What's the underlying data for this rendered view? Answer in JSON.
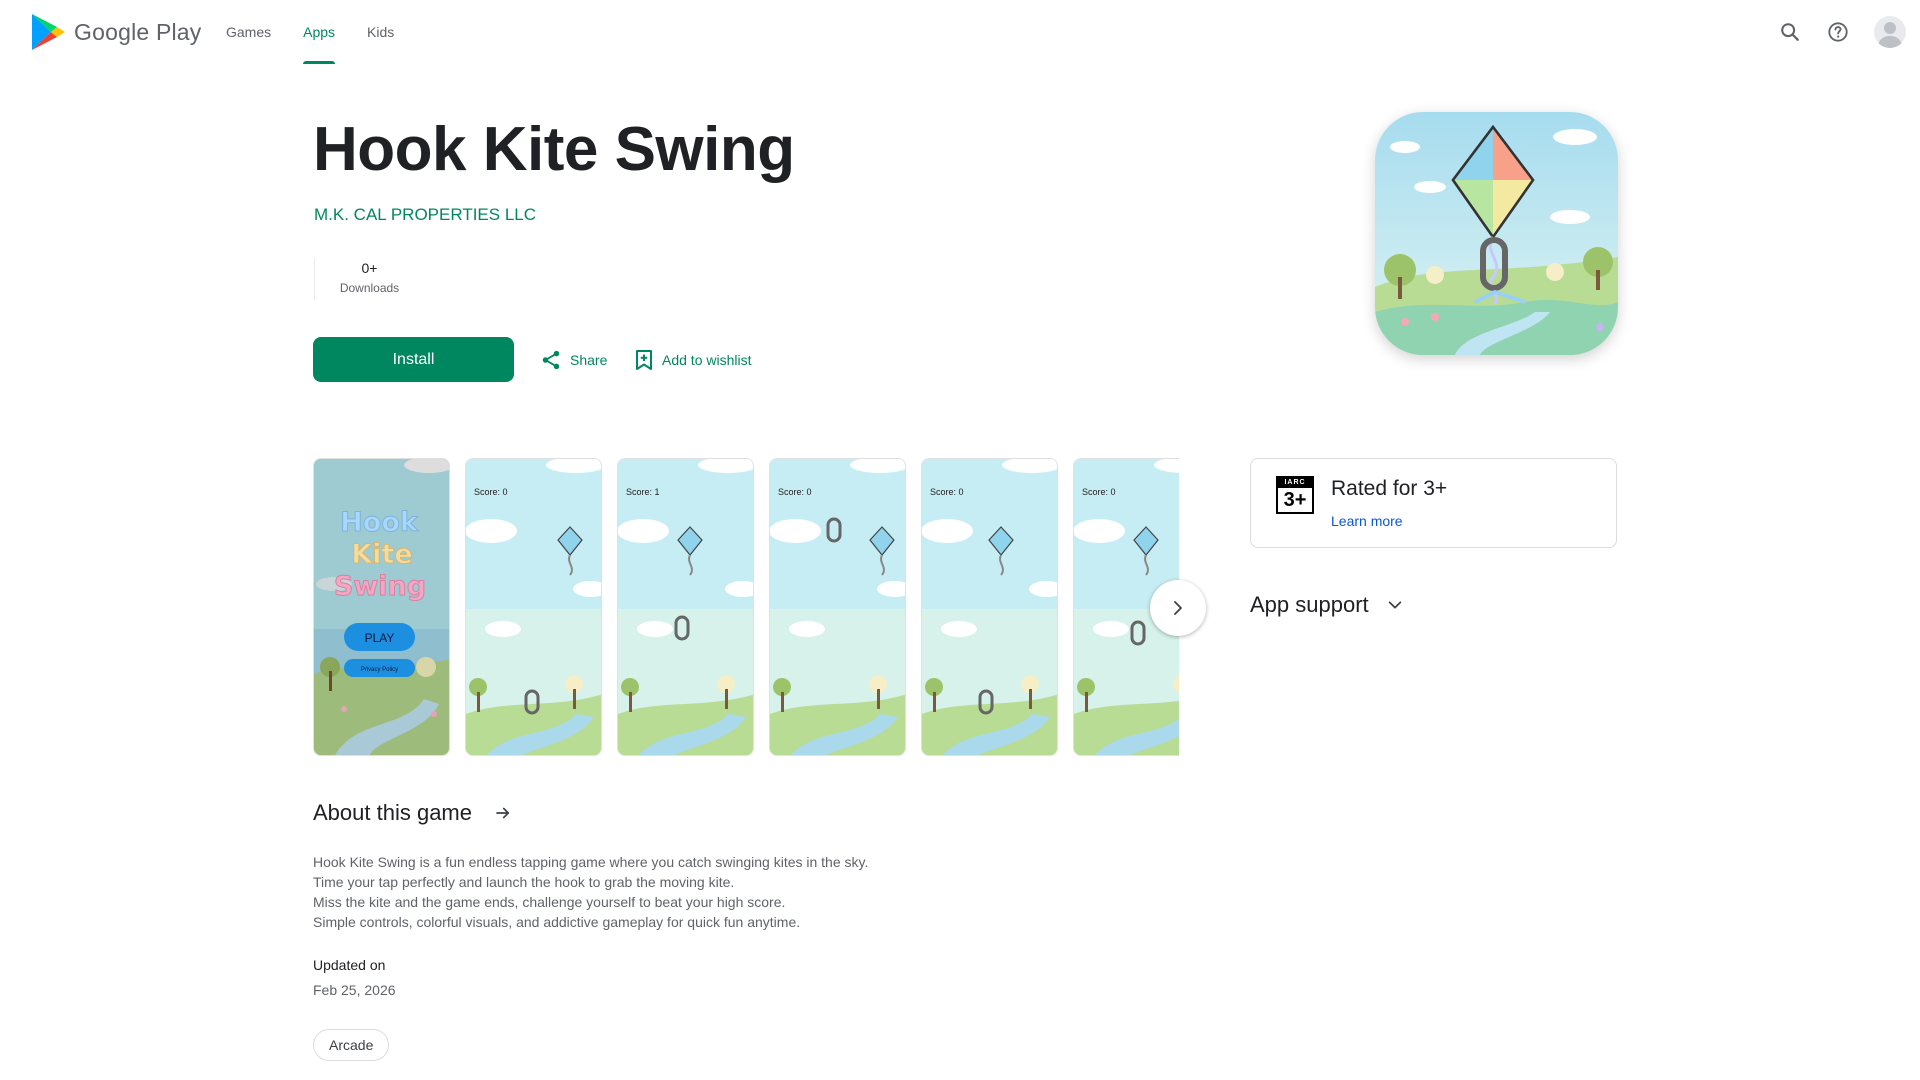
{
  "header": {
    "logo_text": "Google Play",
    "tabs": [
      {
        "label": "Games",
        "active": false
      },
      {
        "label": "Apps",
        "active": true
      },
      {
        "label": "Kids",
        "active": false
      }
    ],
    "icons": [
      "search-icon",
      "help-icon",
      "account-avatar"
    ]
  },
  "app": {
    "title": "Hook Kite Swing",
    "developer": "M.K. CAL PROPERTIES LLC",
    "stats": [
      {
        "value": "0+",
        "label": "Downloads"
      }
    ],
    "install_label": "Install",
    "share_label": "Share",
    "wishlist_label": "Add to wishlist"
  },
  "screenshots": [
    {
      "kind": "title",
      "title_lines": [
        "Hook",
        "Kite",
        "Swing"
      ],
      "play_label": "PLAY",
      "privacy_label": "Privacy Policy"
    },
    {
      "kind": "game",
      "score": "Score: 0"
    },
    {
      "kind": "game",
      "score": "Score: 1"
    },
    {
      "kind": "game",
      "score": "Score: 0"
    },
    {
      "kind": "game",
      "score": "Score: 0"
    },
    {
      "kind": "game",
      "score": "Score: 0"
    }
  ],
  "rating": {
    "badge_top": "IARC",
    "badge_num": "3+",
    "text": "Rated for 3+",
    "learn_more": "Learn more"
  },
  "support": {
    "label": "App support"
  },
  "about": {
    "title": "About this game",
    "description": [
      "Hook Kite Swing is a fun endless tapping game where you catch swinging kites in the sky.",
      "Time your tap perfectly and launch the hook to grab the moving kite.",
      "Miss the kite and the game ends, challenge yourself to beat your high score.",
      "Simple controls, colorful visuals, and addictive gameplay for quick fun anytime."
    ],
    "updated_label": "Updated on",
    "updated_value": "Feb 25, 2026",
    "tag": "Arcade"
  },
  "colors": {
    "accent": "#01875f",
    "link": "#0b57d0",
    "text": "#202124",
    "muted": "#5f6368"
  }
}
